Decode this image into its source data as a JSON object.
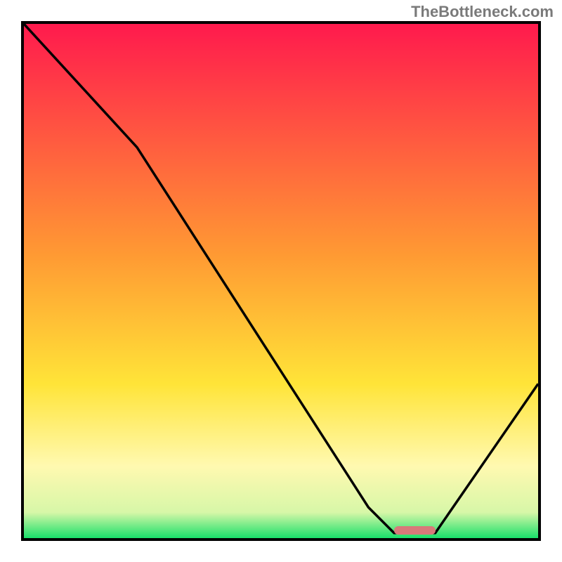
{
  "watermark": "TheBottleneck.com",
  "chart_data": {
    "type": "line",
    "title": "",
    "xlabel": "",
    "ylabel": "",
    "xlim": [
      0,
      100
    ],
    "ylim": [
      0,
      100
    ],
    "curve": [
      {
        "x": 0,
        "y": 100
      },
      {
        "x": 22,
        "y": 76
      },
      {
        "x": 67,
        "y": 6
      },
      {
        "x": 72,
        "y": 1
      },
      {
        "x": 80,
        "y": 1
      },
      {
        "x": 100,
        "y": 30
      }
    ],
    "optimal_zone": {
      "x_start": 72,
      "x_end": 80,
      "y": 1.5
    },
    "gradient_stops": [
      {
        "pos": 0,
        "color": "#ff1a4d"
      },
      {
        "pos": 45,
        "color": "#ff9a33"
      },
      {
        "pos": 70,
        "color": "#ffe438"
      },
      {
        "pos": 86,
        "color": "#fff9b0"
      },
      {
        "pos": 95,
        "color": "#d7f7a8"
      },
      {
        "pos": 100,
        "color": "#19e06a"
      }
    ]
  }
}
